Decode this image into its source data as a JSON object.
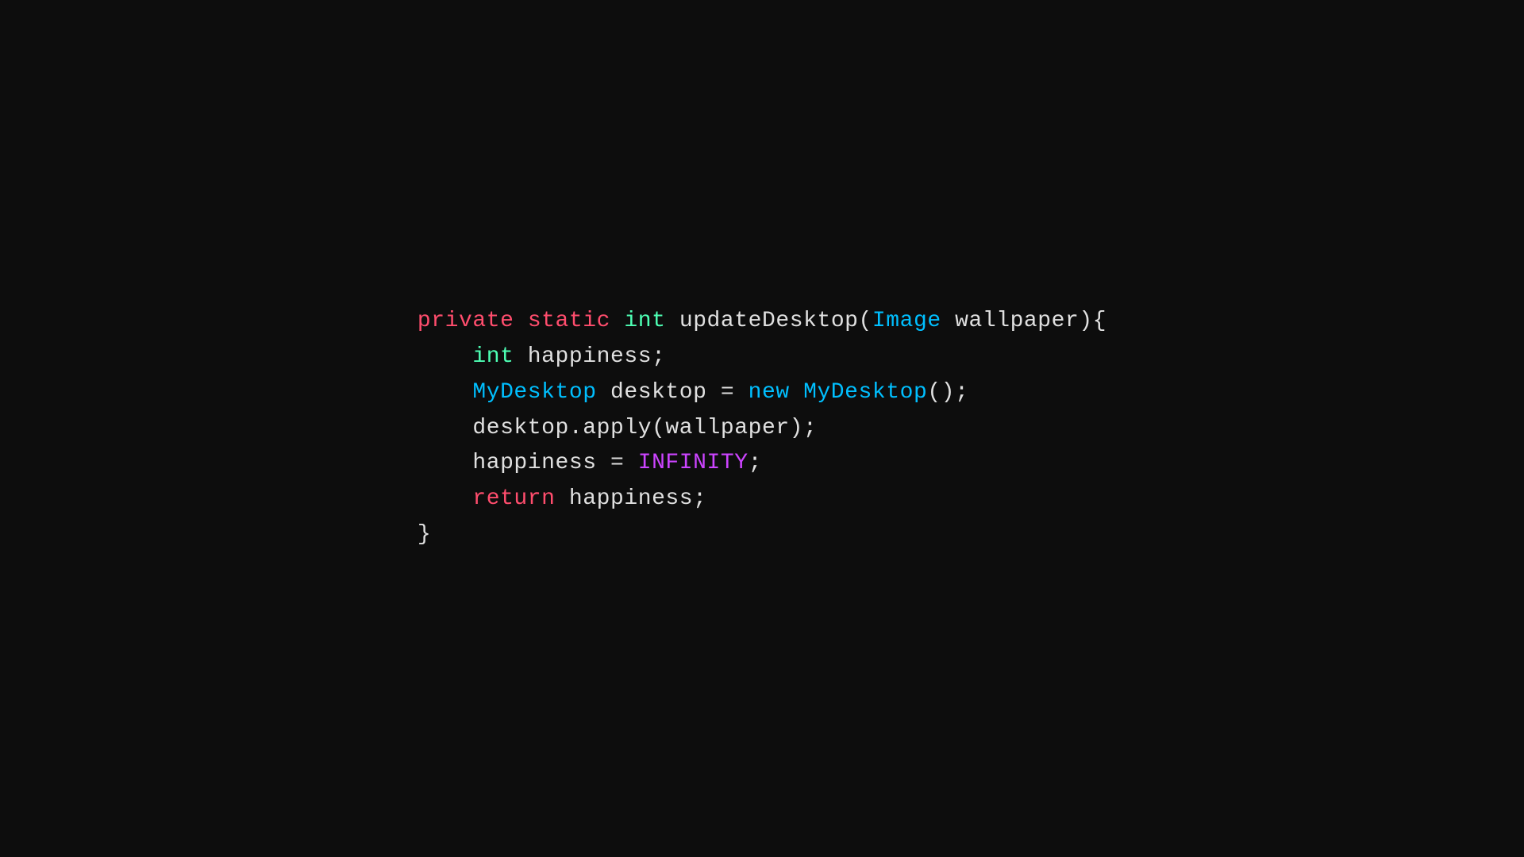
{
  "code": {
    "background": "#0d0d0d",
    "lines": [
      {
        "id": "line1",
        "parts": [
          {
            "text": "private",
            "class": "keyword-private"
          },
          {
            "text": " ",
            "class": "plain"
          },
          {
            "text": "static",
            "class": "keyword-static"
          },
          {
            "text": " ",
            "class": "plain"
          },
          {
            "text": "int",
            "class": "keyword-int"
          },
          {
            "text": " updateDesktop(",
            "class": "plain"
          },
          {
            "text": "Image",
            "class": "class-name"
          },
          {
            "text": " wallpaper){",
            "class": "plain"
          }
        ]
      },
      {
        "id": "line2",
        "parts": [
          {
            "text": "    ",
            "class": "plain"
          },
          {
            "text": "int",
            "class": "keyword-int"
          },
          {
            "text": " happiness;",
            "class": "plain"
          }
        ]
      },
      {
        "id": "line3",
        "parts": [
          {
            "text": "    ",
            "class": "plain"
          },
          {
            "text": "MyDesktop",
            "class": "class-name"
          },
          {
            "text": " desktop = ",
            "class": "plain"
          },
          {
            "text": "new",
            "class": "keyword-new"
          },
          {
            "text": " ",
            "class": "plain"
          },
          {
            "text": "MyDesktop",
            "class": "class-name"
          },
          {
            "text": "();",
            "class": "plain"
          }
        ]
      },
      {
        "id": "line4",
        "parts": [
          {
            "text": "    desktop.apply(wallpaper);",
            "class": "plain"
          }
        ]
      },
      {
        "id": "line5",
        "parts": [
          {
            "text": "    happiness = ",
            "class": "plain"
          },
          {
            "text": "INFINITY",
            "class": "constant"
          },
          {
            "text": ";",
            "class": "plain"
          }
        ]
      },
      {
        "id": "line6",
        "parts": [
          {
            "text": "    ",
            "class": "plain"
          },
          {
            "text": "return",
            "class": "keyword-return"
          },
          {
            "text": " happiness;",
            "class": "plain"
          }
        ]
      },
      {
        "id": "line7",
        "parts": [
          {
            "text": "}",
            "class": "plain"
          }
        ]
      }
    ]
  }
}
